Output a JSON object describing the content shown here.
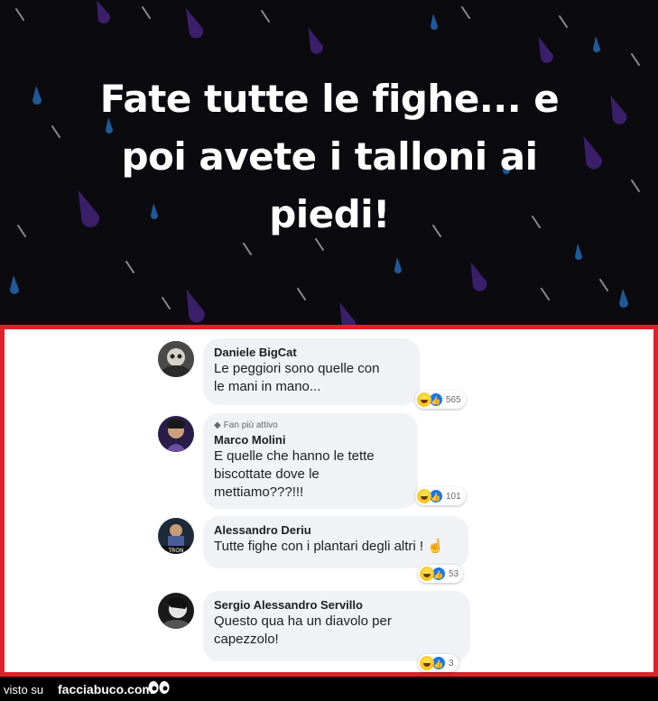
{
  "post": {
    "line1": "Fate tutte le fighe... e",
    "line2": "poi avete i talloni ai",
    "line3": "piedi!"
  },
  "comments": [
    {
      "author": "Daniele BigCat",
      "line1": "Le peggiori sono quelle con",
      "line2": "le mani in mano...",
      "reactions": "565"
    },
    {
      "badge": "Fan più attivo",
      "author": "Marco Molini",
      "line1": "E quelle che hanno le tette",
      "line2": "biscottate dove le",
      "line3": "mettiamo???!!!",
      "reactions": "101"
    },
    {
      "author": "Alessandro Deriu",
      "line1": "Tutte fighe con i plantari degli altri !",
      "reactions": "53"
    },
    {
      "author": "Sergio Alessandro Servillo",
      "line1": "Questo qua ha un diavolo per",
      "line2": "capezzolo!",
      "reactions": "3"
    }
  ],
  "footer": {
    "visto": "visto su",
    "site": "facciabuco.com"
  },
  "colors": {
    "frame": "#e3202a",
    "bubble": "#f0f2f5",
    "like": "#1877f2"
  }
}
